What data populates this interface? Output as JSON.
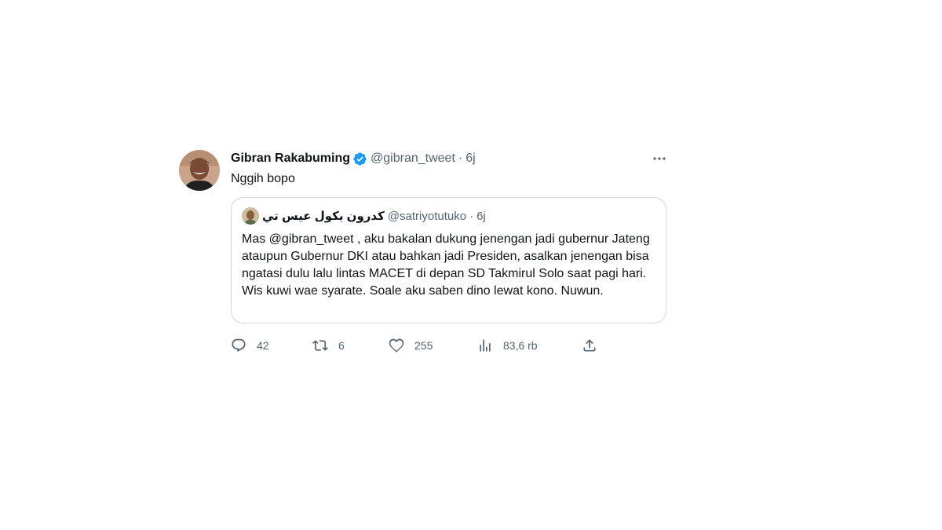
{
  "tweet": {
    "author_name": "Gibran Rakabuming",
    "author_handle": "@gibran_tweet",
    "separator": "·",
    "time": "6j",
    "text": "Nggih bopo"
  },
  "quoted_tweet": {
    "author_name": "كدرون بكول عيس تي",
    "author_handle": "@satriyotutuko",
    "separator": "·",
    "time": "6j",
    "text": "Mas @gibran_tweet , aku bakalan dukung jenengan jadi gubernur Jateng ataupun Gubernur DKI atau bahkan jadi Presiden, asalkan jenengan bisa ngatasi dulu lalu lintas MACET di depan SD Takmirul Solo saat pagi hari. Wis kuwi wae syarate. Soale aku saben dino lewat kono. Nuwun."
  },
  "actions": {
    "replies": "42",
    "retweets": "6",
    "likes": "255",
    "views": "83,6 rb"
  },
  "icons": {
    "verified": "verified-badge-icon",
    "more": "more-dots-icon",
    "reply": "reply-bubble-icon",
    "retweet": "retweet-icon",
    "like": "heart-icon",
    "views": "views-chart-icon",
    "share": "share-icon"
  },
  "colors": {
    "text_primary": "#0f1419",
    "text_secondary": "#536471",
    "verified_blue": "#1d9bf0",
    "border": "#cfd9de"
  }
}
